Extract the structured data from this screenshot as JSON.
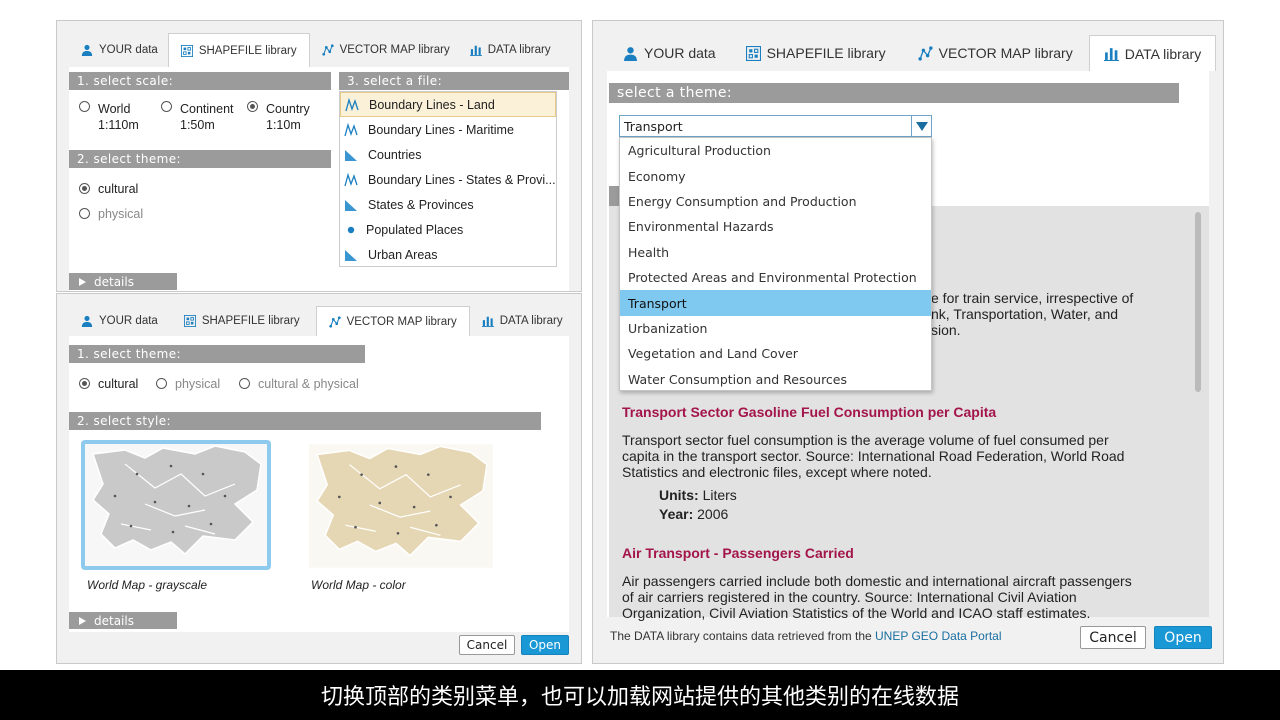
{
  "tabs": [
    "YOUR data",
    "SHAPEFILE library",
    "VECTOR MAP library",
    "DATA library"
  ],
  "shapefile": {
    "scale_header": "1. select scale:",
    "scales": [
      {
        "name": "World",
        "value": "1:110m"
      },
      {
        "name": "Continent",
        "value": "1:50m"
      },
      {
        "name": "Country",
        "value": "1:10m"
      }
    ],
    "selected_scale": "Country",
    "theme_header": "2. select theme:",
    "themes": [
      "cultural",
      "physical"
    ],
    "file_header": "3. select a file:",
    "files": [
      {
        "label": "Boundary Lines - Land",
        "icon": "line-icon"
      },
      {
        "label": "Boundary Lines - Maritime",
        "icon": "line-icon"
      },
      {
        "label": "Countries",
        "icon": "polygon-icon"
      },
      {
        "label": "Boundary Lines - States & Provi...",
        "icon": "line-icon"
      },
      {
        "label": "States & Provinces",
        "icon": "polygon-icon"
      },
      {
        "label": "Populated Places",
        "icon": "point-icon"
      },
      {
        "label": "Urban Areas",
        "icon": "polygon-icon"
      }
    ],
    "details": "details"
  },
  "vector": {
    "theme_header": "1. select theme:",
    "themes": [
      "cultural",
      "physical",
      "cultural & physical"
    ],
    "style_header": "2. select style:",
    "styles": [
      "World Map - grayscale",
      "World Map - color"
    ],
    "details": "details",
    "cancel": "Cancel",
    "open": "Open"
  },
  "datalib": {
    "theme_header": "select a theme:",
    "selected": "Transport",
    "options": [
      "Agricultural Production",
      "Economy",
      "Energy Consumption and Production",
      "Environmental Hazards",
      "Health",
      "Protected Areas and Environmental Protection",
      "Transport",
      "Urbanization",
      "Vegetation and Land Cover",
      "Water Consumption and Resources"
    ],
    "partial_lines": [
      "e for train service, irrespective of",
      "nk, Transportation, Water, and",
      "sion."
    ],
    "item1_title": "Transport Sector Gasoline Fuel Consumption per Capita",
    "item1_desc": [
      "Transport sector fuel consumption is the average volume of fuel consumed per",
      "capita in the transport sector. Source: International Road Federation, World Road",
      "Statistics and electronic files, except where noted."
    ],
    "units_label": "Units:",
    "units_value": "Liters",
    "year_label": "Year:",
    "year_value": "2006",
    "item2_title": "Air Transport - Passengers Carried",
    "item2_desc": [
      "Air passengers carried include both domestic and international aircraft passengers",
      "of air carriers registered in the country. Source: International Civil Aviation",
      "Organization, Civil Aviation Statistics of the World and ICAO staff estimates."
    ],
    "footer_text": "The DATA library contains data retrieved from the ",
    "footer_link": "UNEP GEO Data Portal",
    "cancel": "Cancel",
    "open": "Open"
  },
  "subtitle": "切换顶部的类别菜单，也可以加载网站提供的其他类别的在线数据",
  "colors": {
    "accent": "#1a98d5",
    "highlight": "#7fc8f0",
    "title_red": "#a3154a",
    "section_gray": "#9b9b9b"
  }
}
